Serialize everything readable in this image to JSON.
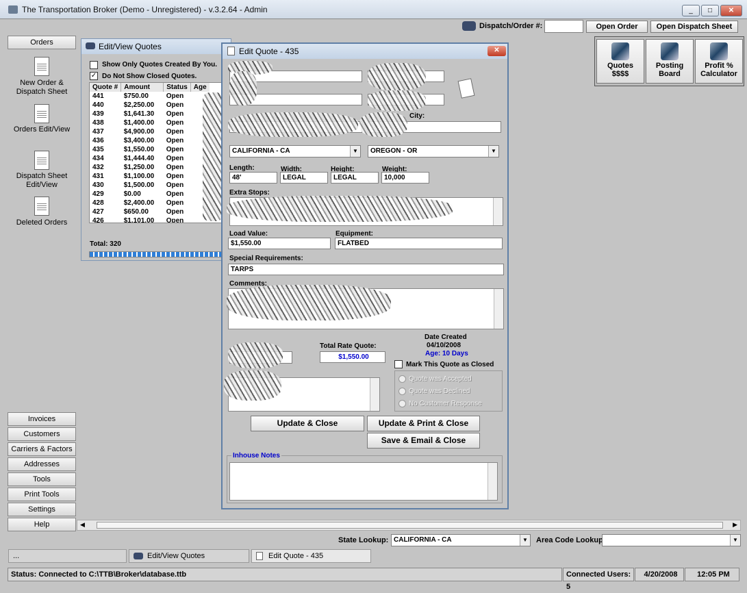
{
  "app": {
    "title": "The Transportation Broker (Demo - Unregistered) - v.3.2.64 - Admin"
  },
  "toolbar": {
    "dispatch_label": "Dispatch/Order #:",
    "dispatch_value": "",
    "open_order": "Open Order",
    "open_dispatch": "Open Dispatch Sheet"
  },
  "tiles": [
    {
      "label": "Quotes\n$$$$"
    },
    {
      "label": "Posting\nBoard"
    },
    {
      "label": "Profit %\nCalculator"
    }
  ],
  "sidebar": {
    "header": "Orders",
    "items": [
      {
        "label": "New Order & Dispatch Sheet"
      },
      {
        "label": "Orders Edit/View"
      },
      {
        "label": "Dispatch Sheet Edit/View"
      },
      {
        "label": "Deleted Orders"
      }
    ],
    "bottom": [
      "Invoices",
      "Customers",
      "Carriers & Factors",
      "Addresses",
      "Tools",
      "Print Tools",
      "Settings",
      "Help"
    ]
  },
  "quotes_window": {
    "title": "Edit/View Quotes",
    "chk1": "Show Only Quotes Created By You.",
    "chk2": "Do Not Show Closed Quotes.",
    "columns": [
      "Quote #",
      "Amount",
      "Status",
      "Age"
    ],
    "rows": [
      [
        "441",
        "$750.00",
        "Open"
      ],
      [
        "440",
        "$2,250.00",
        "Open"
      ],
      [
        "439",
        "$1,641.30",
        "Open"
      ],
      [
        "438",
        "$1,400.00",
        "Open"
      ],
      [
        "437",
        "$4,900.00",
        "Open"
      ],
      [
        "436",
        "$3,400.00",
        "Open"
      ],
      [
        "435",
        "$1,550.00",
        "Open"
      ],
      [
        "434",
        "$1,444.40",
        "Open"
      ],
      [
        "432",
        "$1,250.00",
        "Open"
      ],
      [
        "431",
        "$1,100.00",
        "Open"
      ],
      [
        "430",
        "$1,500.00",
        "Open"
      ],
      [
        "429",
        "$0.00",
        "Open"
      ],
      [
        "428",
        "$2,400.00",
        "Open"
      ],
      [
        "427",
        "$650.00",
        "Open"
      ],
      [
        "426",
        "$1,101.00",
        "Open"
      ]
    ],
    "total": "Total: 320"
  },
  "edit_quote": {
    "title": "Edit Quote - 435",
    "origin_state_label": "",
    "origin_state": "CALIFORNIA - CA",
    "dest_state_label": "",
    "dest_state": "OREGON - OR",
    "dest_city_label": "City:",
    "length_label": "Length:",
    "length": "48'",
    "width_label": "Width:",
    "width": "LEGAL",
    "height_label": "Height:",
    "height": "LEGAL",
    "weight_label": "Weight:",
    "weight": "10,000",
    "extra_stops_label": "Extra Stops:",
    "load_value_label": "Load Value:",
    "load_value": "$1,550.00",
    "equipment_label": "Equipment:",
    "equipment": "FLATBED",
    "special_label": "Special Requirements:",
    "special": "TARPS",
    "comments_label": "Comments:",
    "total_rate_label": "Total Rate Quote:",
    "total_rate": "$1,550.00",
    "date_created_label": "Date Created",
    "date_created": "04/10/2008",
    "age": "Age: 10 Days",
    "agent_signature_label": "",
    "mark_closed": "Mark This Quote as Closed",
    "radio1": "Quote was Accepted",
    "radio2": "Quote was Declined",
    "radio3": "No Customer Response",
    "btn_update_close": "Update & Close",
    "btn_update_print": "Update & Print & Close",
    "btn_save_email": "Save & Email & Close",
    "inhouse_label": "Inhouse Notes"
  },
  "lookup": {
    "state_label": "State Lookup:",
    "state_value": "CALIFORNIA - CA",
    "area_label": "Area Code Lookup:",
    "area_value": ""
  },
  "taskbar": {
    "dots": "...",
    "t1": "Edit/View Quotes",
    "t2": "Edit Quote - 435"
  },
  "status": {
    "text": "Status: Connected to C:\\TTB\\Broker\\database.ttb",
    "users": "Connected Users: 5",
    "date": "4/20/2008",
    "time": "12:05 PM"
  },
  "colors": {
    "blue_text": "#0000cc",
    "title_bg": "#dbe5f1"
  }
}
